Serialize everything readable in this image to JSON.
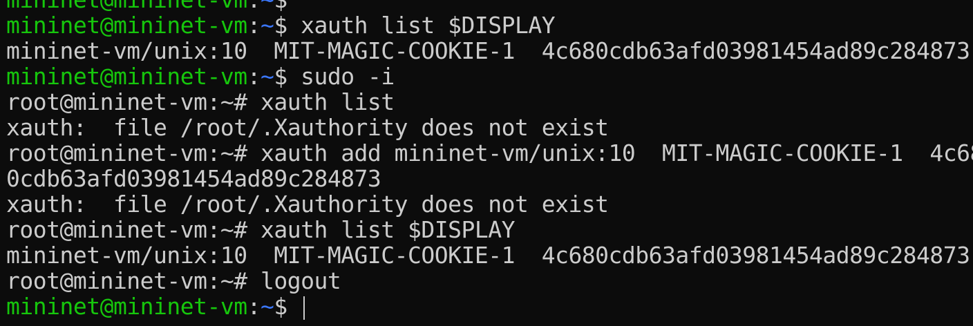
{
  "theme": {
    "background": "#0c0c0c",
    "foreground": "#cccccc",
    "prompt_user_color": "#16c60c",
    "prompt_path_color": "#3b78ff"
  },
  "lines": {
    "l0": {
      "user": "mininet@mininet-vm",
      "colon": ":",
      "path": "~",
      "symbol": "$",
      "command": ""
    },
    "l1": {
      "user": "mininet@mininet-vm",
      "colon": ":",
      "path": "~",
      "symbol": "$",
      "command": " xauth list $DISPLAY"
    },
    "l2": {
      "text": "mininet-vm/unix:10  MIT-MAGIC-COOKIE-1  4c680cdb63afd03981454ad89c284873"
    },
    "l3": {
      "user": "mininet@mininet-vm",
      "colon": ":",
      "path": "~",
      "symbol": "$",
      "command": " sudo -i"
    },
    "l4": {
      "text": "root@mininet-vm:~# xauth list"
    },
    "l5": {
      "text": "xauth:  file /root/.Xauthority does not exist"
    },
    "l6": {
      "text": "root@mininet-vm:~# xauth add mininet-vm/unix:10  MIT-MAGIC-COOKIE-1  4c68"
    },
    "l7": {
      "text": "0cdb63afd03981454ad89c284873"
    },
    "l8": {
      "text": "xauth:  file /root/.Xauthority does not exist"
    },
    "l9": {
      "text": "root@mininet-vm:~# xauth list $DISPLAY"
    },
    "l10": {
      "text": "mininet-vm/unix:10  MIT-MAGIC-COOKIE-1  4c680cdb63afd03981454ad89c284873"
    },
    "l11": {
      "text": "root@mininet-vm:~# logout"
    },
    "l12": {
      "user": "mininet@mininet-vm",
      "colon": ":",
      "path": "~",
      "symbol": "$",
      "command": " "
    }
  }
}
